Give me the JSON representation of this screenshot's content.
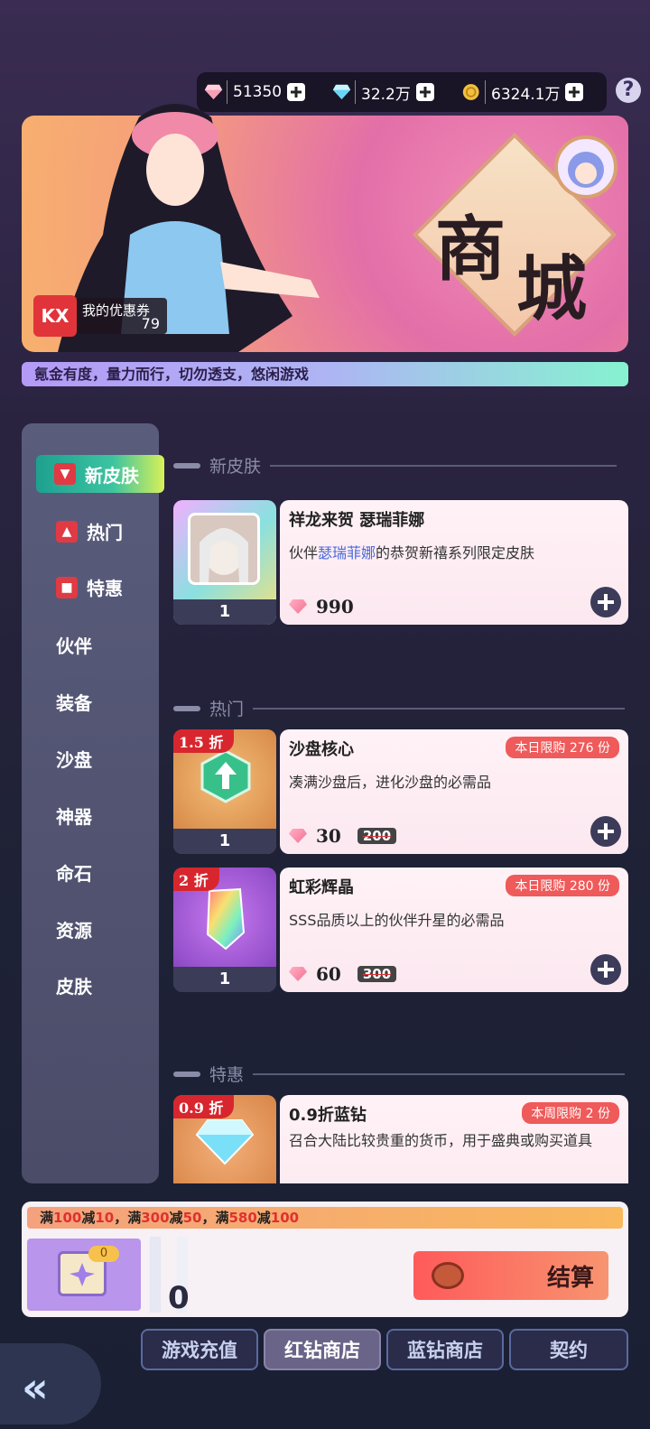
{
  "currency": [
    {
      "icon": "red-diamond-icon",
      "value": "51350"
    },
    {
      "icon": "blue-diamond-icon",
      "value": "32.2万"
    },
    {
      "icon": "gold-coin-icon",
      "value": "6324.1万"
    }
  ],
  "help_label": "?",
  "banner": {
    "title_a": "商",
    "title_b": "城",
    "coupon_label": "我的优惠券",
    "coupon_count": "79",
    "coupon_icon": "KX"
  },
  "notice": "氪金有度，量力而行，切勿透支，悠闲游戏",
  "sidebar": {
    "active": "新皮肤",
    "items": [
      "热门",
      "特惠",
      "伙伴",
      "装备",
      "沙盘",
      "神器",
      "命石",
      "资源",
      "皮肤"
    ]
  },
  "sections": {
    "new_skin": "新皮肤",
    "hot": "热门",
    "special": "特惠"
  },
  "products": [
    {
      "name": "祥龙来贺 瑟瑞菲娜",
      "desc_pre": "伙伴",
      "desc_link": "瑟瑞菲娜",
      "desc_post": "的恭贺新禧系列限定皮肤",
      "price": "990",
      "count": "1"
    },
    {
      "name": "沙盘核心",
      "desc": "凑满沙盘后，进化沙盘的必需品",
      "price": "30",
      "orig": "200",
      "discount": "1.5 折",
      "limit": "本日限购 276 份",
      "count": "1"
    },
    {
      "name": "虹彩辉晶",
      "desc": "SSS品质以上的伙伴升星的必需品",
      "price": "60",
      "orig": "300",
      "discount": "2 折",
      "limit": "本日限购 280 份",
      "count": "1"
    },
    {
      "name": "0.9折蓝钻",
      "desc": "召合大陆比较贵重的货币，用于盛典或购买道具",
      "discount": "0.9 折",
      "limit": "本周限购 2 份"
    }
  ],
  "checkout": {
    "promo": [
      {
        "pre": "满",
        "a": "100",
        "mid": "减",
        "b": "10"
      },
      {
        "pre": "，满",
        "a": "300",
        "mid": "减",
        "b": "50"
      },
      {
        "pre": "，满",
        "a": "580",
        "mid": "减",
        "b": "100"
      }
    ],
    "cart_count": "0",
    "total": "0",
    "pay_label": "结算"
  },
  "tabs": [
    "游戏充值",
    "红钻商店",
    "蓝钻商店",
    "契约"
  ],
  "active_tab": "红钻商店",
  "colors": {
    "accent": "#ef5a5a",
    "active_nav": "#3cc4a0",
    "bg": "#2a2340"
  }
}
